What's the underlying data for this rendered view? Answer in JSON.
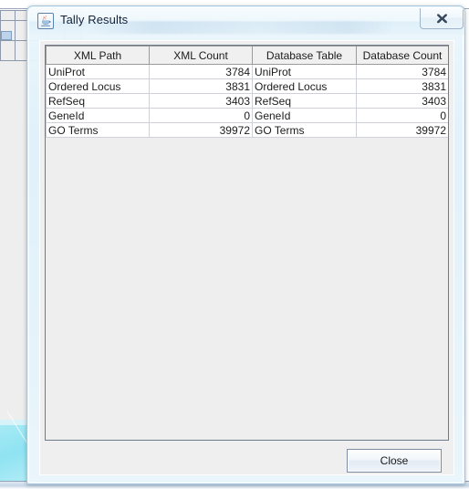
{
  "window": {
    "title": "Tally Results",
    "app_icon": "java-coffee-cup-icon",
    "close_icon": "close-x-icon"
  },
  "table": {
    "columns": [
      "XML Path",
      "XML Count",
      "Database Table",
      "Database Count"
    ],
    "rows": [
      [
        "UniProt",
        "3784",
        "UniProt",
        "3784"
      ],
      [
        "Ordered Locus",
        "3831",
        "Ordered Locus",
        "3831"
      ],
      [
        "RefSeq",
        "3403",
        "RefSeq",
        "3403"
      ],
      [
        "GeneId",
        "0",
        "GeneId",
        "0"
      ],
      [
        "GO Terms",
        "39972",
        "GO Terms",
        "39972"
      ]
    ]
  },
  "buttons": {
    "close": "Close"
  },
  "colors": {
    "frame_border": "#a8c6dd",
    "table_header_bg": "#f0f0f0",
    "client_bg": "#efefef",
    "desktop_accent": "#8fe3f2"
  }
}
